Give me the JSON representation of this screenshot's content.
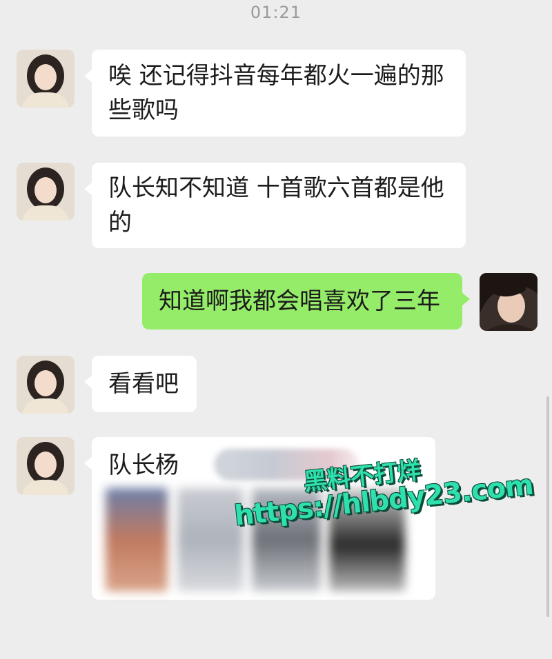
{
  "status": {
    "time": "01:21"
  },
  "messages": [
    {
      "text": "唉 还记得抖音每年都火一遍的那些歌吗"
    },
    {
      "text": "队长知不知道 十首歌六首都是他的"
    },
    {
      "text": "知道啊我都会唱喜欢了三年"
    },
    {
      "text": "看看吧"
    },
    {
      "text": "队长杨"
    }
  ],
  "watermark": {
    "line1": "黑料不打烊",
    "line2": "https://hlbdy23.com"
  },
  "colors": {
    "background": "#ededed",
    "incoming_bubble": "#ffffff",
    "outgoing_bubble": "#95ec69",
    "watermark": "#2fe0ae"
  }
}
